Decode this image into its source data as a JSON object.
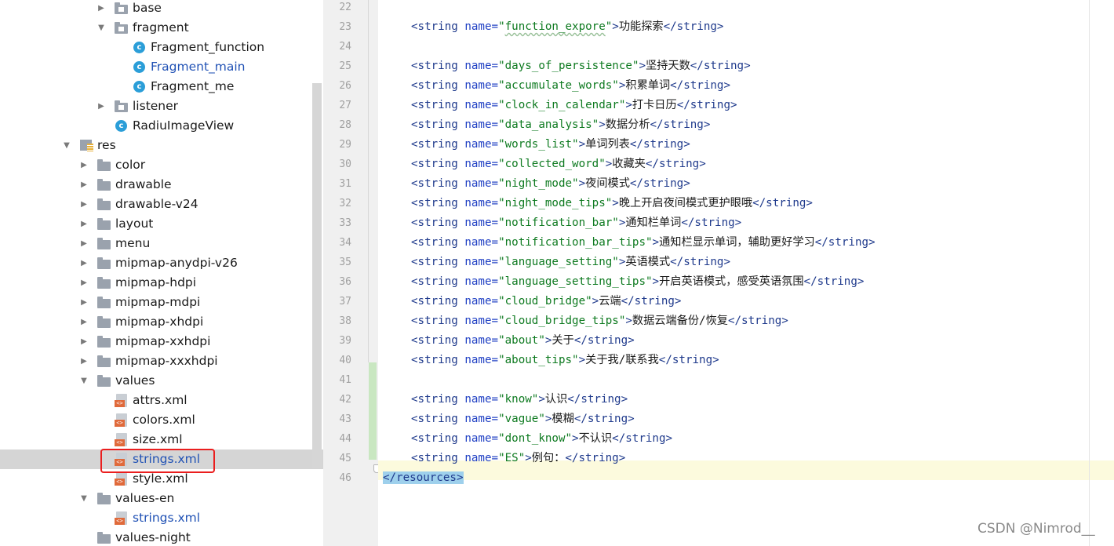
{
  "project_tree": {
    "rows": [
      {
        "label": "base",
        "icon": "folder-icon",
        "expanded": false
      },
      {
        "label": "fragment",
        "icon": "folder-icon",
        "expanded": true
      },
      {
        "label": "Fragment_function",
        "icon": "class-icon"
      },
      {
        "label": "Fragment_main",
        "icon": "class-icon",
        "modified": true
      },
      {
        "label": "Fragment_me",
        "icon": "class-icon"
      },
      {
        "label": "listener",
        "icon": "folder-icon",
        "expanded": false
      },
      {
        "label": "RadiuImageView",
        "icon": "class-icon"
      },
      {
        "label": "res",
        "icon": "res-folder-icon",
        "expanded": true
      },
      {
        "label": "color",
        "icon": "folder-icon",
        "expanded": false
      },
      {
        "label": "drawable",
        "icon": "folder-icon",
        "expanded": false
      },
      {
        "label": "drawable-v24",
        "icon": "folder-icon",
        "expanded": false
      },
      {
        "label": "layout",
        "icon": "folder-icon",
        "expanded": false
      },
      {
        "label": "menu",
        "icon": "folder-icon",
        "expanded": false
      },
      {
        "label": "mipmap-anydpi-v26",
        "icon": "folder-icon",
        "expanded": false
      },
      {
        "label": "mipmap-hdpi",
        "icon": "folder-icon",
        "expanded": false
      },
      {
        "label": "mipmap-mdpi",
        "icon": "folder-icon",
        "expanded": false
      },
      {
        "label": "mipmap-xhdpi",
        "icon": "folder-icon",
        "expanded": false
      },
      {
        "label": "mipmap-xxhdpi",
        "icon": "folder-icon",
        "expanded": false
      },
      {
        "label": "mipmap-xxxhdpi",
        "icon": "folder-icon",
        "expanded": false
      },
      {
        "label": "values",
        "icon": "folder-icon",
        "expanded": true
      },
      {
        "label": "attrs.xml",
        "icon": "xml-file-icon"
      },
      {
        "label": "colors.xml",
        "icon": "xml-file-icon"
      },
      {
        "label": "size.xml",
        "icon": "xml-file-icon"
      },
      {
        "label": "strings.xml",
        "icon": "xml-file-icon",
        "selected": true,
        "modified": true
      },
      {
        "label": "style.xml",
        "icon": "xml-file-icon"
      },
      {
        "label": "values-en",
        "icon": "folder-icon",
        "expanded": true
      },
      {
        "label": "strings.xml",
        "icon": "xml-file-icon",
        "modified": true
      },
      {
        "label": "values-night",
        "icon": "folder-icon",
        "expanded": false
      }
    ]
  },
  "editor": {
    "line_numbers": [
      "22",
      "23",
      "24",
      "25",
      "26",
      "27",
      "28",
      "29",
      "30",
      "31",
      "32",
      "33",
      "34",
      "35",
      "36",
      "37",
      "38",
      "39",
      "40",
      "41",
      "42",
      "43",
      "44",
      "45",
      "46"
    ],
    "lines": [
      {
        "name": "",
        "text": ""
      },
      {
        "name": "function_expore",
        "text": "功能探索"
      },
      {
        "name": "",
        "text": ""
      },
      {
        "name": "days_of_persistence",
        "text": "坚持天数"
      },
      {
        "name": "accumulate_words",
        "text": "积累单词"
      },
      {
        "name": "clock_in_calendar",
        "text": "打卡日历"
      },
      {
        "name": "data_analysis",
        "text": "数据分析"
      },
      {
        "name": "words_list",
        "text": "单词列表"
      },
      {
        "name": "collected_word",
        "text": "收藏夹"
      },
      {
        "name": "night_mode",
        "text": "夜间模式"
      },
      {
        "name": "night_mode_tips",
        "text": "晚上开启夜间模式更护眼哦"
      },
      {
        "name": "notification_bar",
        "text": "通知栏单词"
      },
      {
        "name": "notification_bar_tips",
        "text": "通知栏显示单词，辅助更好学习"
      },
      {
        "name": "language_setting",
        "text": "英语模式"
      },
      {
        "name": "language_setting_tips",
        "text": "开启英语模式，感受英语氛围"
      },
      {
        "name": "cloud_bridge",
        "text": "云端"
      },
      {
        "name": "cloud_bridge_tips",
        "text": "数据云端备份/恢复"
      },
      {
        "name": "about",
        "text": "关于"
      },
      {
        "name": "about_tips",
        "text": "关于我/联系我"
      },
      {
        "name": "",
        "text": ""
      },
      {
        "name": "know",
        "text": "认识"
      },
      {
        "name": "vague",
        "text": "模糊"
      },
      {
        "name": "dont_know",
        "text": "不认识"
      },
      {
        "name": "ES",
        "text": "例句："
      },
      {
        "closing": "</resources>"
      }
    ],
    "syntax": {
      "open_tag": "<string",
      "attr": "name=",
      "close_tag": "</string>"
    }
  },
  "watermark": "CSDN @Nimrod__",
  "colors": {
    "selection": "#d5d5d5",
    "highlight_box": "#ea1e1e",
    "caret_line": "#fcfadd",
    "tag": "#1f3a8c",
    "attr_value": "#0e7a20",
    "modified_file": "#2152b5"
  }
}
